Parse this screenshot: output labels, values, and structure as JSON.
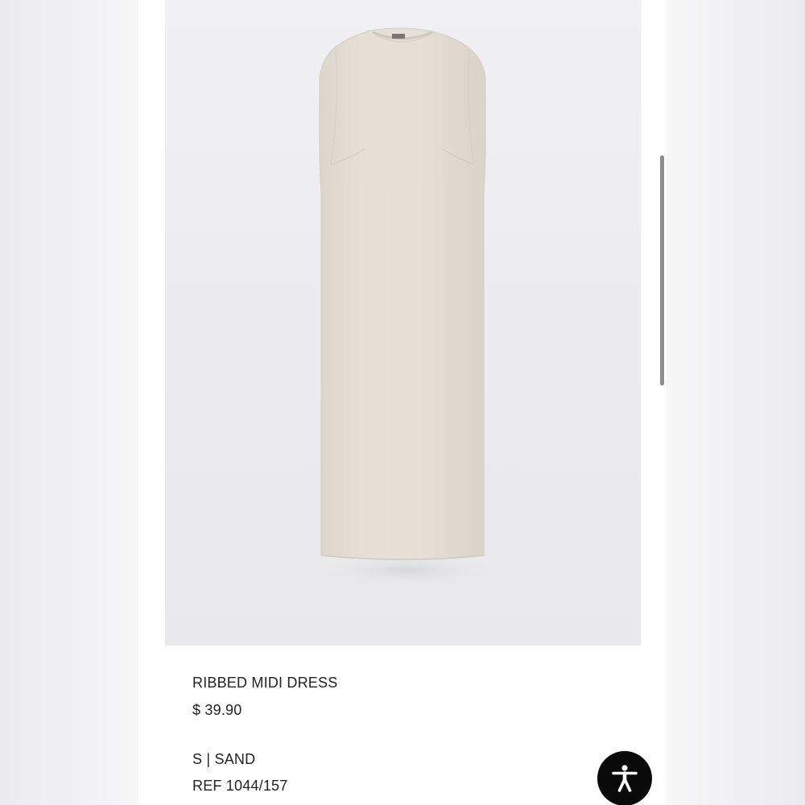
{
  "product": {
    "name": "RIBBED MIDI DRESS",
    "price": "$ 39.90",
    "variant": "S | SAND",
    "reference": "REF 1044/157"
  },
  "image": {
    "subject": "dress-photo",
    "garment_color": "#e3ddd4",
    "background_color": "#efeff1"
  },
  "accessibility": {
    "icon": "accessibility-icon",
    "button_color": "#0a0a0a"
  }
}
